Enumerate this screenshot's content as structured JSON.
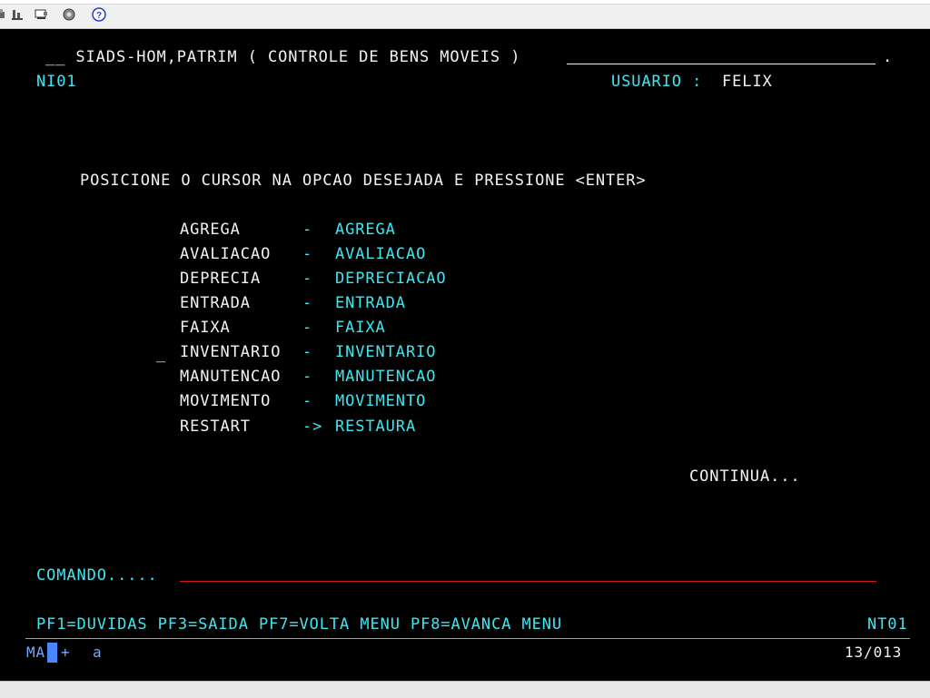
{
  "toolbar": {
    "icons": [
      "print-icon",
      "save-icon",
      "copy-screen-icon",
      "settings-icon",
      "help-icon"
    ]
  },
  "header": {
    "title": "__ SIADS-HOM,PATRIM ( CONTROLE DE BENS MOVEIS )",
    "title_end": ".",
    "screen_id": "NI01",
    "user_label": "USUARIO :",
    "user_name": "FELIX"
  },
  "instruction": "POSICIONE O CURSOR NA OPCAO DESEJADA E PRESSIONE <ENTER>",
  "menu": {
    "cursor_marker": "_",
    "items": [
      {
        "code": "AGREGA",
        "sep": "-",
        "desc": "AGREGA"
      },
      {
        "code": "AVALIACAO",
        "sep": "-",
        "desc": "AVALIACAO"
      },
      {
        "code": "DEPRECIA",
        "sep": "-",
        "desc": "DEPRECIACAO"
      },
      {
        "code": "ENTRADA",
        "sep": "-",
        "desc": "ENTRADA"
      },
      {
        "code": "FAIXA",
        "sep": "-",
        "desc": "FAIXA"
      },
      {
        "code": "INVENTARIO",
        "sep": "-",
        "desc": "INVENTARIO"
      },
      {
        "code": "MANUTENCAO",
        "sep": "-",
        "desc": "MANUTENCAO"
      },
      {
        "code": "MOVIMENTO",
        "sep": "-",
        "desc": "MOVIMENTO"
      },
      {
        "code": "RESTART",
        "sep": "->",
        "desc": "RESTAURA"
      }
    ]
  },
  "continua": "CONTINUA...",
  "command": {
    "label": "COMANDO.....",
    "value": ""
  },
  "function_keys": {
    "text": "PF1=DUVIDAS PF3=SAIDA PF7=VOLTA MENU PF8=AVANCA MENU",
    "screen_code": "NT01"
  },
  "status": {
    "mode": "MA",
    "indicator": "+",
    "input": "a",
    "position": "13/013"
  },
  "colors": {
    "background": "#000000",
    "text_white": "#f2f2f2",
    "text_cyan": "#3ee6f0",
    "text_blue": "#6fa8ff",
    "field_underline": "#d21b1b",
    "cursor": "#4a86ff"
  }
}
